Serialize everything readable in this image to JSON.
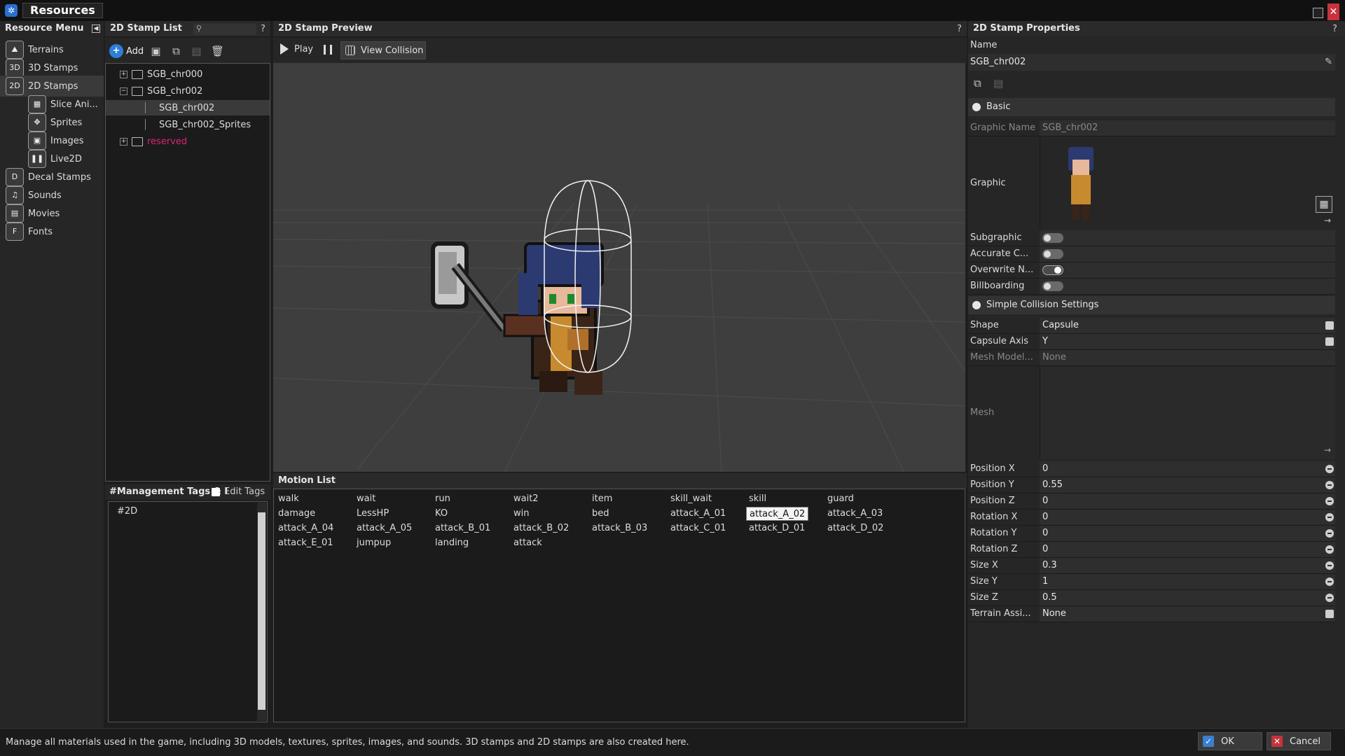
{
  "window": {
    "title": "Resources"
  },
  "resource_menu": {
    "title": "Resource Menu",
    "items": [
      {
        "label": "Terrains",
        "icon": "terrain-icon"
      },
      {
        "label": "3D Stamps",
        "icon": "3d-stamp-icon"
      },
      {
        "label": "2D Stamps",
        "icon": "2d-stamp-icon"
      },
      {
        "label": "Slice Ani...",
        "icon": "slice-animation-icon"
      },
      {
        "label": "Sprites",
        "icon": "sprite-icon"
      },
      {
        "label": "Images",
        "icon": "image-icon"
      },
      {
        "label": "Live2D",
        "icon": "live2d-icon"
      },
      {
        "label": "Decal Stamps",
        "icon": "decal-icon"
      },
      {
        "label": "Sounds",
        "icon": "music-note-icon"
      },
      {
        "label": "Movies",
        "icon": "film-icon"
      },
      {
        "label": "Fonts",
        "icon": "font-icon"
      }
    ]
  },
  "stamp_list": {
    "title": "2D Stamp List",
    "help": "?",
    "add_label": "Add",
    "tree": [
      {
        "label": "SGB_chr000",
        "type": "folder",
        "expander": "+"
      },
      {
        "label": "SGB_chr002",
        "type": "folder",
        "expander": "−"
      },
      {
        "label": "SGB_chr002",
        "type": "stamp"
      },
      {
        "label": "SGB_chr002_Sprites",
        "type": "sprite"
      },
      {
        "label": "reserved",
        "type": "folder",
        "expander": "+"
      }
    ]
  },
  "tags": {
    "title": "#Management Tags &amp; I",
    "edit_label": "Edit Tags",
    "items": [
      "#2D"
    ]
  },
  "preview": {
    "title": "2D Stamp Preview",
    "help": "?",
    "play_label": "Play",
    "view_collision_label": "View Collision"
  },
  "motion_list": {
    "title": "Motion List",
    "items": [
      "walk",
      "wait",
      "run",
      "wait2",
      "item",
      "skill_wait",
      "skill",
      "guard",
      "damage",
      "LessHP",
      "KO",
      "win",
      "bed",
      "attack_A_01",
      "attack_A_02",
      "attack_A_03",
      "attack_A_04",
      "attack_A_05",
      "attack_B_01",
      "attack_B_02",
      "attack_B_03",
      "attack_C_01",
      "attack_D_01",
      "attack_D_02",
      "attack_E_01",
      "jumpup",
      "landing",
      "attack"
    ],
    "selected": "attack_A_02"
  },
  "properties": {
    "title": "2D Stamp Properties",
    "help": "?",
    "name_label": "Name",
    "name_value": "SGB_chr002",
    "basic_section": "Basic",
    "graphic_name_label": "Graphic Name",
    "graphic_name_value": "SGB_chr002",
    "graphic_label": "Graphic",
    "subgraphic_label": "Subgraphic",
    "accurate_label": "Accurate C...",
    "overwrite_label": "Overwrite N...",
    "billboarding_label": "Billboarding",
    "collision_section": "Simple Collision Settings",
    "shape_label": "Shape",
    "shape_value": "Capsule",
    "capsule_axis_label": "Capsule Axis",
    "capsule_axis_value": "Y",
    "mesh_model_label": "Mesh Model...",
    "mesh_model_value": "None",
    "mesh_label": "Mesh",
    "fields": [
      {
        "label": "Position X",
        "value": "0"
      },
      {
        "label": "Position Y",
        "value": "0.55"
      },
      {
        "label": "Position Z",
        "value": "0"
      },
      {
        "label": "Rotation X",
        "value": "0"
      },
      {
        "label": "Rotation Y",
        "value": "0"
      },
      {
        "label": "Rotation Z",
        "value": "0"
      },
      {
        "label": "Size X",
        "value": "0.3"
      },
      {
        "label": "Size Y",
        "value": "1"
      },
      {
        "label": "Size Z",
        "value": "0.5"
      }
    ],
    "terrain_label": "Terrain Assi...",
    "terrain_value": "None"
  },
  "status": {
    "text": "Manage all materials used in the game, including 3D models, textures, sprites, images, and sounds. 3D stamps and 2D stamps are also created here."
  },
  "buttons": {
    "ok": "OK",
    "cancel": "Cancel"
  },
  "colors": {
    "accent": "#2d7fd8",
    "reserved_folder": "#e0207a",
    "close": "#c8323c"
  }
}
